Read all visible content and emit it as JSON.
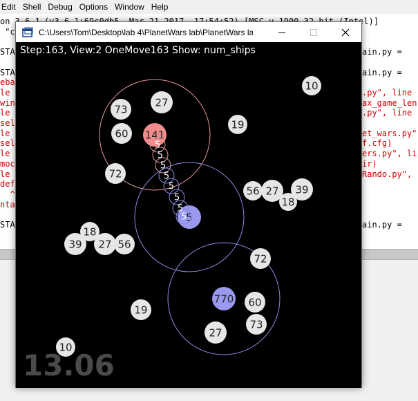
{
  "shell": {
    "menu": [
      "Edit",
      "Shell",
      "Debug",
      "Options",
      "Window",
      "Help"
    ],
    "lines_left": [
      {
        "text": "on 3.6.1",
        "color": "blk"
      },
      {
        "text": " \"c",
        "color": "blk"
      },
      {
        "text": "",
        "color": "blk"
      },
      {
        "text": "STA",
        "color": "blk"
      },
      {
        "text": "",
        "color": "blk"
      },
      {
        "text": "STA",
        "color": "blk"
      },
      {
        "text": "eba",
        "color": "red"
      },
      {
        "text": "le ",
        "color": "red"
      },
      {
        "text": "win",
        "color": "red"
      },
      {
        "text": "le ",
        "color": "red"
      },
      {
        "text": "sel",
        "color": "red"
      },
      {
        "text": "le ",
        "color": "red"
      },
      {
        "text": "sel",
        "color": "red"
      },
      {
        "text": "le ",
        "color": "red"
      },
      {
        "text": "moc",
        "color": "red"
      },
      {
        "text": "le ",
        "color": "red"
      },
      {
        "text": "def",
        "color": "red"
      },
      {
        "text": "  ^",
        "color": "red"
      },
      {
        "text": "nta",
        "color": "red"
      },
      {
        "text": "",
        "color": "blk"
      },
      {
        "text": "STA",
        "color": "blk"
      }
    ],
    "top_right": "(v3.6.1:69c0db5, Mar 21 2017, 17:54:52) [MSC v.1900 32 bit (Intel)]",
    "lines_right": [
      {
        "row": 3,
        "text": "ain.py =",
        "color": "blk"
      },
      {
        "row": 5,
        "text": "ain.py =",
        "color": "blk"
      },
      {
        "row": 7,
        "text": ".py\", line",
        "color": "red"
      },
      {
        "row": 8,
        "text": "ax_game_len",
        "color": "red"
      },
      {
        "row": 9,
        "text": ".py\", line",
        "color": "red"
      },
      {
        "row": 11,
        "text": "et_wars.py\"",
        "color": "red"
      },
      {
        "row": 12,
        "text": "f.cfg)",
        "color": "red"
      },
      {
        "row": 13,
        "text": "ers.py\", li",
        "color": "red"
      },
      {
        "row": 14,
        "text": "ir)",
        "color": "red"
      },
      {
        "row": 15,
        "text": "Rando.py\",",
        "color": "red"
      },
      {
        "row": 20,
        "text": "ain.py =",
        "color": "blk"
      }
    ]
  },
  "window": {
    "title": "C:\\Users\\Tom\\Desktop\\lab 4\\PlanetWars lab\\PlanetWars lab\\...",
    "minimize_icon": "minimize-icon",
    "maximize_icon": "maximize-icon",
    "close_icon": "close-icon"
  },
  "game": {
    "status": "Step:163, View:2 OneMove163 Show: num_ships",
    "timer": "13.06",
    "colors": {
      "neutral": "#e6e6e6",
      "player1": "#f08c8c",
      "player2": "#9999f0",
      "ring1": "#e69a9a",
      "ring2": "#8c8ce6",
      "fleet_text": "#ffffff"
    },
    "planets": [
      {
        "label": "10",
        "owner": "neutral"
      },
      {
        "label": "27",
        "owner": "neutral"
      },
      {
        "label": "73",
        "owner": "neutral"
      },
      {
        "label": "19",
        "owner": "neutral"
      },
      {
        "label": "60",
        "owner": "neutral"
      },
      {
        "label": "141",
        "owner": "player1"
      },
      {
        "label": "72",
        "owner": "neutral"
      },
      {
        "label": "56",
        "owner": "neutral"
      },
      {
        "label": "27",
        "owner": "neutral"
      },
      {
        "label": "39",
        "owner": "neutral"
      },
      {
        "label": "18",
        "owner": "neutral"
      },
      {
        "label": "5",
        "owner": "player2"
      },
      {
        "label": "18",
        "owner": "neutral"
      },
      {
        "label": "39",
        "owner": "neutral"
      },
      {
        "label": "27",
        "owner": "neutral"
      },
      {
        "label": "56",
        "owner": "neutral"
      },
      {
        "label": "72",
        "owner": "neutral"
      },
      {
        "label": "770",
        "owner": "player2"
      },
      {
        "label": "60",
        "owner": "neutral"
      },
      {
        "label": "19",
        "owner": "neutral"
      },
      {
        "label": "73",
        "owner": "neutral"
      },
      {
        "label": "27",
        "owner": "neutral"
      },
      {
        "label": "10",
        "owner": "neutral"
      }
    ],
    "fleets": [
      {
        "label": "5"
      },
      {
        "label": "5"
      },
      {
        "label": "5"
      },
      {
        "label": "5"
      },
      {
        "label": "5"
      },
      {
        "label": "5"
      },
      {
        "label": "5"
      },
      {
        "label": "5"
      }
    ]
  }
}
